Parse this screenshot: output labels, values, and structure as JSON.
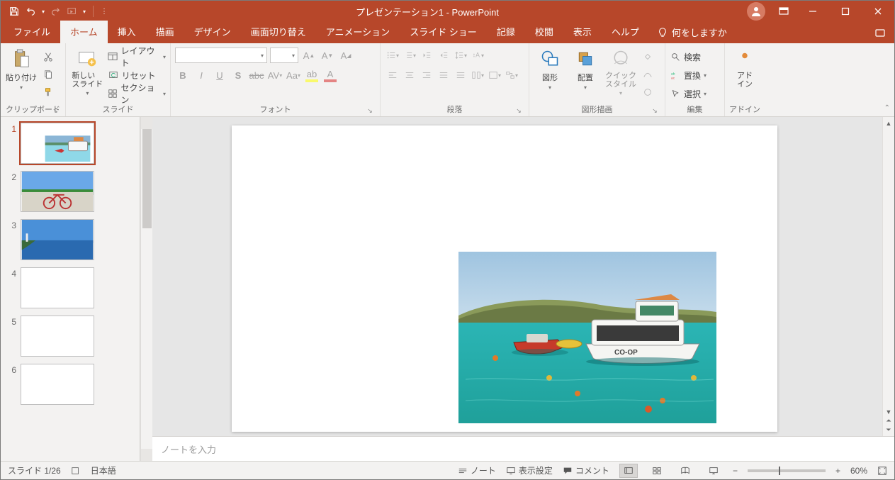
{
  "app": {
    "title": "プレゼンテーション1  -  PowerPoint"
  },
  "qat": {
    "save_icon": "save-icon",
    "undo_icon": "undo-icon",
    "redo_icon": "redo-icon",
    "startfrom_icon": "start-from-beginning-icon"
  },
  "tabs": {
    "file": "ファイル",
    "home": "ホーム",
    "insert": "挿入",
    "draw": "描画",
    "design": "デザイン",
    "transitions": "画面切り替え",
    "animations": "アニメーション",
    "slideshow": "スライド ショー",
    "record": "記録",
    "review": "校閲",
    "view": "表示",
    "help": "ヘルプ",
    "tell_me": "何をしますか"
  },
  "ribbon": {
    "clipboard": {
      "label": "クリップボード",
      "paste": "貼り付け"
    },
    "slides": {
      "label": "スライド",
      "new_slide": "新しい\nスライド",
      "layout": "レイアウト",
      "reset": "リセット",
      "section": "セクション"
    },
    "font": {
      "label": "フォント",
      "name_placeholder": "",
      "size_placeholder": ""
    },
    "paragraph": {
      "label": "段落"
    },
    "drawing": {
      "label": "図形描画",
      "shapes": "図形",
      "arrange": "配置",
      "quick_styles": "クイック\nスタイル"
    },
    "editing": {
      "label": "編集",
      "find": "検索",
      "replace": "置換",
      "select": "選択"
    },
    "addins": {
      "label": "アドイン",
      "button": "アド\nイン"
    }
  },
  "thumbnails": {
    "items": [
      {
        "n": "1",
        "kind": "boat",
        "selected": true
      },
      {
        "n": "2",
        "kind": "bike",
        "selected": false
      },
      {
        "n": "3",
        "kind": "coast",
        "selected": false
      },
      {
        "n": "4",
        "kind": "blank",
        "selected": false
      },
      {
        "n": "5",
        "kind": "blank",
        "selected": false
      },
      {
        "n": "6",
        "kind": "blank",
        "selected": false
      }
    ]
  },
  "notes": {
    "placeholder": "ノートを入力"
  },
  "statusbar": {
    "slide_counter": "スライド 1/26",
    "language": "日本語",
    "notes_btn": "ノート",
    "display_settings": "表示設定",
    "comments": "コメント",
    "zoom_pct": "60%"
  }
}
